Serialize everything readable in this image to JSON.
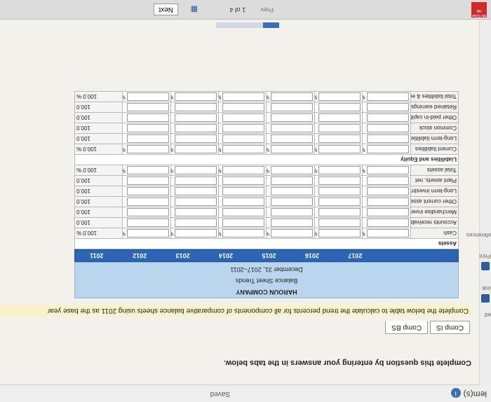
{
  "header": {
    "problems_label": "lem(s)",
    "saved_label": "Saved"
  },
  "sidebar": {
    "labels": [
      "ed",
      "ook",
      "Print",
      "eferences"
    ]
  },
  "instruction": "Complete this question by entering your answers in the tabs below.",
  "tabs": [
    {
      "label": "Comp IS"
    },
    {
      "label": "Comp BS"
    }
  ],
  "intro_text": "Complete the below table to calculate the trend percents for all components of comparative balance sheets using 2011 as the base year",
  "table": {
    "company": "HAROUN COMPANY",
    "subtitle": "Balance Sheet Trends",
    "period": "December 31, 2017–2011",
    "years": [
      "2017",
      "2016",
      "2015",
      "2014",
      "2013",
      "2012",
      "2011"
    ],
    "sections": [
      {
        "title": "Assets",
        "rows": [
          {
            "label": "Cash",
            "base": "100.0",
            "pct": true
          },
          {
            "label": "Accounts receivable, net",
            "base": "100.0",
            "pct": false
          },
          {
            "label": "Merchandise inventory",
            "base": "100.0",
            "pct": false
          },
          {
            "label": "Other current assets",
            "base": "100.0",
            "pct": false
          },
          {
            "label": "Long-term investments",
            "base": "100.0",
            "pct": false
          },
          {
            "label": "Plant assets, net",
            "base": "100.0",
            "pct": false
          },
          {
            "label": "Total assets",
            "base": "100.0",
            "pct": true
          }
        ]
      },
      {
        "title": "Liabilities and Equity",
        "rows": [
          {
            "label": "Current liabilities",
            "base": "100.0",
            "pct": true
          },
          {
            "label": "Long-term liabilities",
            "base": "100.0",
            "pct": false
          },
          {
            "label": "Common stock",
            "base": "100.0",
            "pct": false
          },
          {
            "label": "Other paid-in capital",
            "base": "100.0",
            "pct": false
          },
          {
            "label": "Retained earnings",
            "base": "100.0",
            "pct": false
          },
          {
            "label": "Total liabilities & equity",
            "base": "100.0",
            "pct": true
          }
        ]
      }
    ],
    "pct_symbol": "%"
  },
  "footer": {
    "logo_text": "Mc Graw Hill",
    "prev_label": "Prev",
    "pager_text": "1 of 4",
    "next_label": "Next"
  },
  "progress": 0.25
}
